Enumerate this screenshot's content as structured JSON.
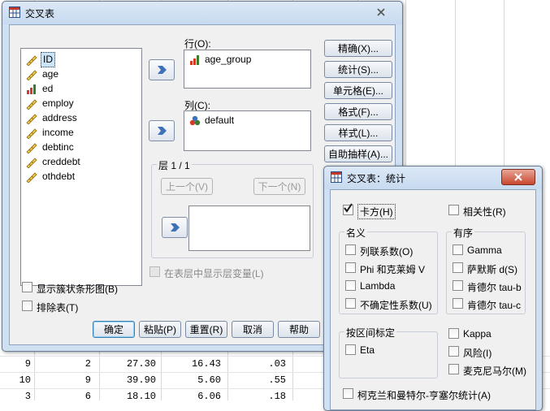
{
  "spreadsheet": {
    "rows": [
      {
        "row": "9",
        "c1": "2",
        "c2": "27.30",
        "c3": "16.43",
        "c4": ".03"
      },
      {
        "row": "10",
        "c1": "9",
        "c2": "39.90",
        "c3": "5.60",
        "c4": ".55"
      },
      {
        "row": "3",
        "c1": "6",
        "c2": "18.10",
        "c3": "6.06",
        "c4": ".18"
      }
    ]
  },
  "crosstabs": {
    "title": "交叉表",
    "variables": [
      "ID",
      "age",
      "ed",
      "employ",
      "address",
      "income",
      "debtinc",
      "creddebt",
      "othdebt"
    ],
    "row_label": "行(O):",
    "row_value": "age_group",
    "col_label": "列(C):",
    "col_value": "default",
    "layer_title": "层 1 / 1",
    "prev_layer": "上一个(V)",
    "next_layer": "下一个(N)",
    "show_layer_vars": "在表层中显示层变量(L)",
    "clustered_bar": "显示簇状条形图(B)",
    "suppress_tables": "排除表(T)",
    "side_buttons": [
      "精确(X)...",
      "统计(S)...",
      "单元格(E)...",
      "格式(F)...",
      "样式(L)...",
      "自助抽样(A)..."
    ],
    "bottom_buttons": [
      "确定",
      "粘贴(P)",
      "重置(R)",
      "取消",
      "帮助"
    ]
  },
  "statistics": {
    "title": "交叉表：统计",
    "chi_square": "卡方(H)",
    "correlations": "相关性(R)",
    "nominal_title": "名义",
    "nominal": [
      "列联系数(O)",
      "Phi 和克莱姆 V",
      "Lambda",
      "不确定性系数(U)"
    ],
    "ordinal_title": "有序",
    "ordinal": [
      "Gamma",
      "萨默斯 d(S)",
      "肯德尔 tau-b",
      "肯德尔 tau-c"
    ],
    "interval_title": "按区间标定",
    "eta": "Eta",
    "kappa": "Kappa",
    "risk": "风险(I)",
    "mcnemar": "麦克尼马尔(M)",
    "cmh": "柯克兰和曼特尔-亨塞尔统计(A)"
  }
}
